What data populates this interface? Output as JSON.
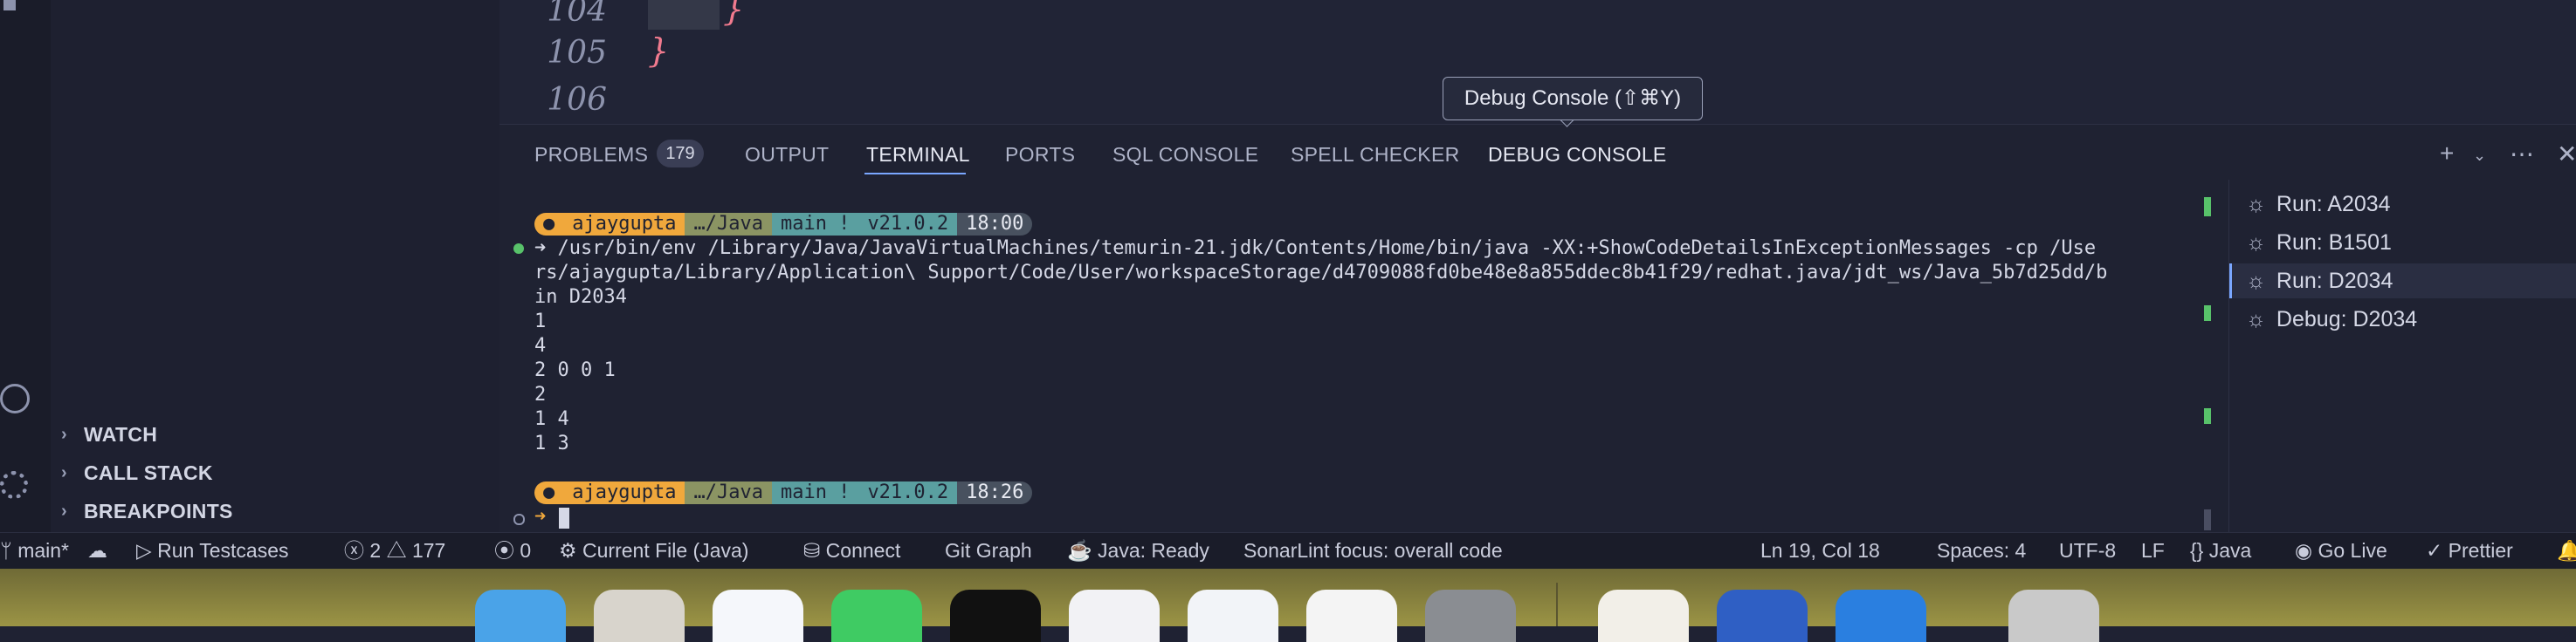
{
  "editor": {
    "line_numbers": [
      "104",
      "105",
      "106"
    ],
    "braces": [
      "}",
      "}"
    ]
  },
  "tooltip": "Debug Console (⇧⌘Y)",
  "panel": {
    "tabs": [
      "PROBLEMS",
      "OUTPUT",
      "TERMINAL",
      "PORTS",
      "SQL CONSOLE",
      "SPELL CHECKER",
      "DEBUG CONSOLE"
    ],
    "problems_count": "179",
    "active_tab": "TERMINAL"
  },
  "sidebar": {
    "sections": [
      "WATCH",
      "CALL STACK",
      "BREAKPOINTS"
    ]
  },
  "terminal": {
    "prompt1": {
      "user": "ajaygupta",
      "dir": "…/Java",
      "branch": "main !",
      "node": "v21.0.2",
      "time": "18:00"
    },
    "command_lines": [
      "➜ /usr/bin/env /Library/Java/JavaVirtualMachines/temurin-21.jdk/Contents/Home/bin/java -XX:+ShowCodeDetailsInExceptionMessages -cp /Use",
      "rs/ajaygupta/Library/Application\\ Support/Code/User/workspaceStorage/d4709088fd0be48e8a855ddec8b41f29/redhat.java/jdt_ws/Java_5b7d25dd/b",
      "in D2034"
    ],
    "output_lines": [
      "1",
      "4",
      "2 0 0 1",
      "2",
      "1 4",
      "1 3"
    ],
    "prompt2": {
      "user": "ajaygupta",
      "dir": "…/Java",
      "branch": "main !",
      "node": "v21.0.2",
      "time": "18:26"
    },
    "cursor_arrow": "➜"
  },
  "terminal_list": [
    "Run: A2034",
    "Run: B1501",
    "Run: D2034",
    "Debug: D2034"
  ],
  "status_bar": {
    "branch": "main*",
    "run_testcases": "Run Testcases",
    "errors": "2",
    "warnings": "177",
    "ports": "0",
    "current_file": "Current File (Java)",
    "connect": "Connect",
    "git_graph": "Git Graph",
    "java_ready": "Java: Ready",
    "sonarlint": "SonarLint focus: overall code",
    "position": "Ln 19, Col 18",
    "spaces": "Spaces: 4",
    "encoding": "UTF-8",
    "eol": "LF",
    "language": "Java",
    "go_live": "Go Live",
    "prettier": "Prettier"
  },
  "colors": {
    "accent": "#7aa7ff",
    "prompt_orange": "#f0a83c",
    "green_mark": "#58c26a"
  }
}
